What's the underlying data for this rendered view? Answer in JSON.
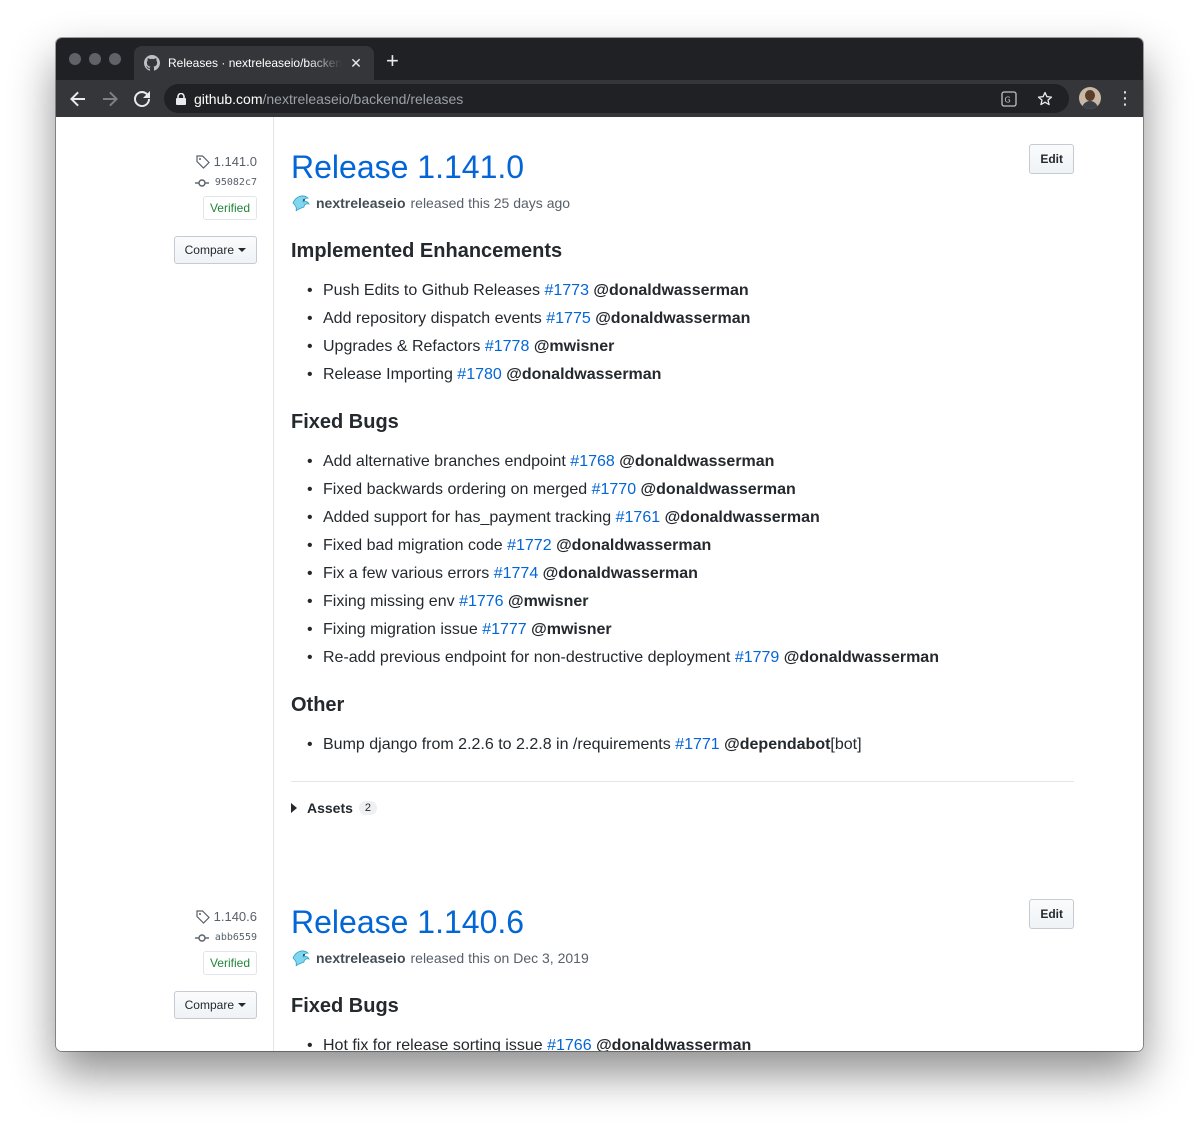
{
  "browser": {
    "tab_title": "Releases · nextreleaseio/backend/releases",
    "url_host": "github.com",
    "url_path": "/nextreleaseio/backend/releases"
  },
  "releases": [
    {
      "tag": "1.141.0",
      "commit": "95082c7",
      "verified": "Verified",
      "compare": "Compare",
      "edit": "Edit",
      "title": "Release 1.141.0",
      "author": "nextreleaseio",
      "released_text": "released this 25 days ago",
      "sections": [
        {
          "heading": "Implemented Enhancements",
          "items": [
            {
              "text": "Push Edits to Github Releases",
              "pr": "#1773",
              "user": "@donaldwasserman",
              "suffix": ""
            },
            {
              "text": "Add repository dispatch events",
              "pr": "#1775",
              "user": "@donaldwasserman",
              "suffix": ""
            },
            {
              "text": "Upgrades & Refactors",
              "pr": "#1778",
              "user": "@mwisner",
              "suffix": ""
            },
            {
              "text": "Release Importing",
              "pr": "#1780",
              "user": "@donaldwasserman",
              "suffix": ""
            }
          ]
        },
        {
          "heading": "Fixed Bugs",
          "items": [
            {
              "text": "Add alternative branches endpoint",
              "pr": "#1768",
              "user": "@donaldwasserman",
              "suffix": ""
            },
            {
              "text": "Fixed backwards ordering on merged",
              "pr": "#1770",
              "user": "@donaldwasserman",
              "suffix": ""
            },
            {
              "text": "Added support for has_payment tracking",
              "pr": "#1761",
              "user": "@donaldwasserman",
              "suffix": ""
            },
            {
              "text": "Fixed bad migration code",
              "pr": "#1772",
              "user": "@donaldwasserman",
              "suffix": ""
            },
            {
              "text": "Fix a few various errors",
              "pr": "#1774",
              "user": "@donaldwasserman",
              "suffix": ""
            },
            {
              "text": "Fixing missing env",
              "pr": "#1776",
              "user": "@mwisner",
              "suffix": ""
            },
            {
              "text": "Fixing migration issue",
              "pr": "#1777",
              "user": "@mwisner",
              "suffix": ""
            },
            {
              "text": "Re-add previous endpoint for non-destructive deployment",
              "pr": "#1779",
              "user": "@donaldwasserman",
              "suffix": ""
            }
          ]
        },
        {
          "heading": "Other",
          "items": [
            {
              "text": "Bump django from 2.2.6 to 2.2.8 in /requirements",
              "pr": "#1771",
              "user": "@dependabot",
              "suffix": "[bot]"
            }
          ]
        }
      ],
      "assets_label": "Assets",
      "assets_count": "2"
    },
    {
      "tag": "1.140.6",
      "commit": "abb6559",
      "verified": "Verified",
      "compare": "Compare",
      "edit": "Edit",
      "title": "Release 1.140.6",
      "author": "nextreleaseio",
      "released_text": "released this on Dec 3, 2019",
      "sections": [
        {
          "heading": "Fixed Bugs",
          "items": [
            {
              "text": "Hot fix for release sorting issue",
              "pr": "#1766",
              "user": "@donaldwasserman",
              "suffix": ""
            }
          ]
        }
      ]
    }
  ],
  "colors": {
    "link": "#0366d6",
    "verified": "#22863a",
    "chrome_dark": "#202124",
    "chrome_toolbar": "#35363a"
  }
}
